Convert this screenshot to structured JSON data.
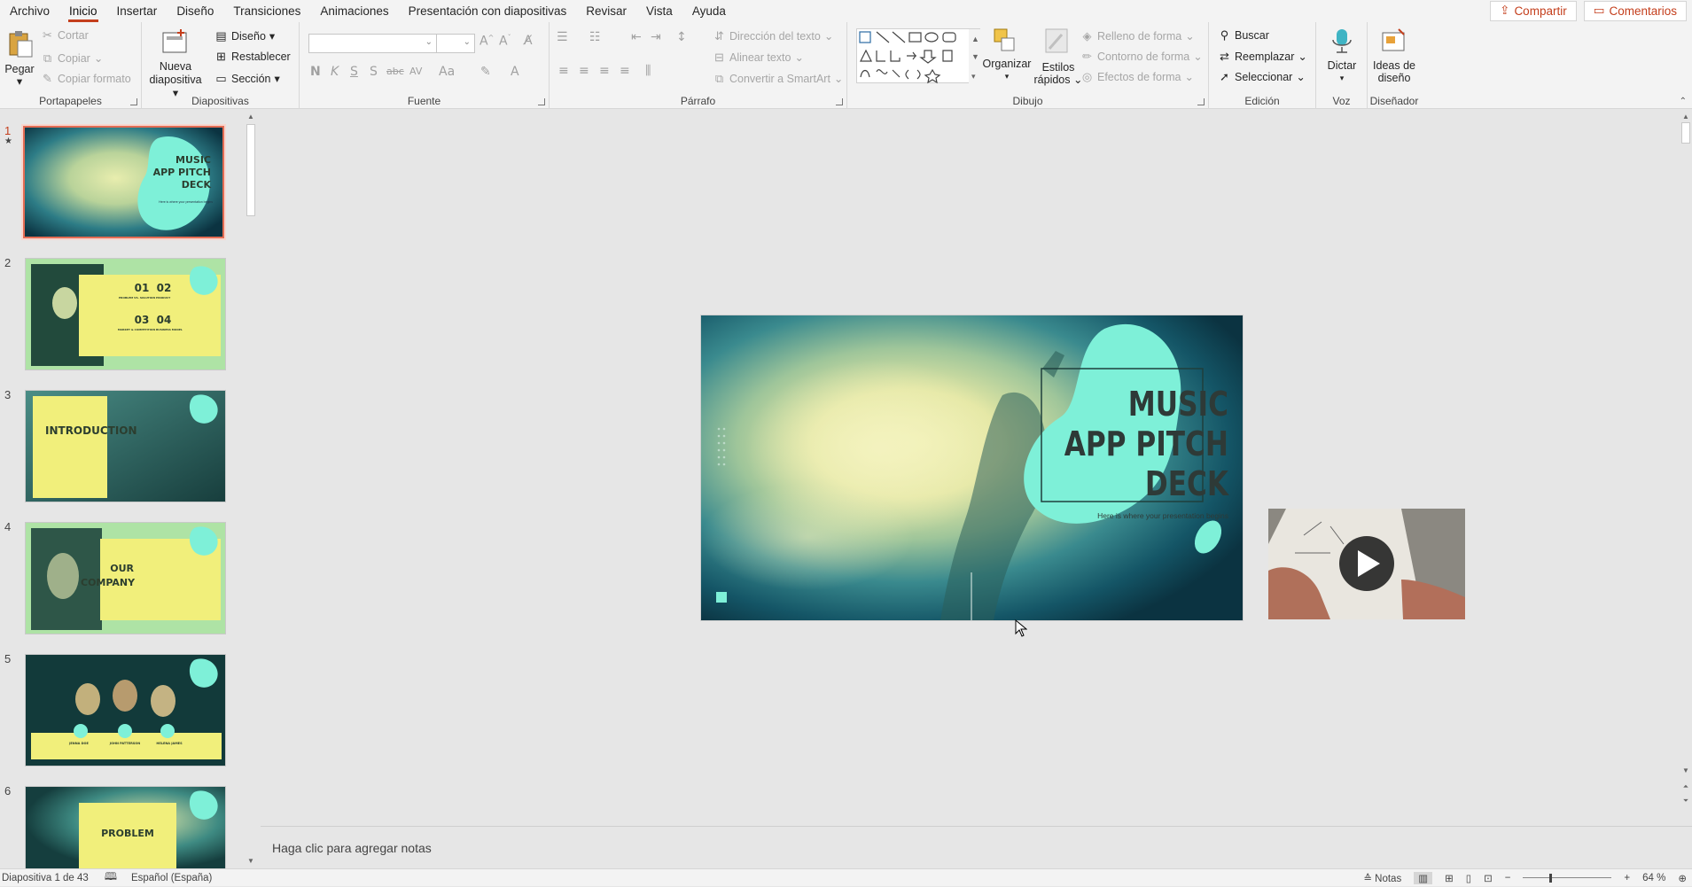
{
  "menu": {
    "tabs": [
      "Archivo",
      "Inicio",
      "Insertar",
      "Diseño",
      "Transiciones",
      "Animaciones",
      "Presentación con diapositivas",
      "Revisar",
      "Vista",
      "Ayuda"
    ],
    "active": "Inicio",
    "share_label": "Compartir",
    "comments_label": "Comentarios"
  },
  "ribbon": {
    "portapapeles": {
      "label": "Portapapeles",
      "paste": "Pegar",
      "cut": "Cortar",
      "copy": "Copiar",
      "format_painter": "Copiar formato"
    },
    "diapositivas": {
      "label": "Diapositivas",
      "new_slide_1": "Nueva",
      "new_slide_2": "diapositiva",
      "layout": "Diseño",
      "reset": "Restablecer",
      "section": "Sección"
    },
    "fuente": {
      "label": "Fuente",
      "bold": "N",
      "italic": "K",
      "underline": "S",
      "shadow": "S",
      "strike": "abc",
      "spacing": "AV",
      "case": "Aa"
    },
    "parrafo": {
      "label": "Párrafo",
      "text_direction": "Dirección del texto",
      "align_text": "Alinear texto",
      "smartart": "Convertir a SmartArt"
    },
    "dibujo": {
      "label": "Dibujo",
      "arrange": "Organizar",
      "styles_1": "Estilos",
      "styles_2": "rápidos",
      "fill": "Relleno de forma",
      "outline": "Contorno de forma",
      "effects": "Efectos de forma"
    },
    "edicion": {
      "label": "Edición",
      "find": "Buscar",
      "replace": "Reemplazar",
      "select": "Seleccionar"
    },
    "voz": {
      "label": "Voz",
      "dictate": "Dictar"
    },
    "disenador": {
      "label": "Diseñador",
      "ideas_1": "Ideas de",
      "ideas_2": "diseño"
    }
  },
  "thumbnails": [
    {
      "num": "1",
      "star": "★",
      "title_lines": [
        "MUSIC",
        "APP PITCH",
        "DECK"
      ],
      "subtitle": "Here is where your presentation begins"
    },
    {
      "num": "2",
      "nums": [
        "01",
        "02",
        "03",
        "04"
      ],
      "labels": [
        "PROBLEM VS. SOLUTION",
        "PRODUCT",
        "MARKET & COMPETITION",
        "BUSINESS MODEL"
      ]
    },
    {
      "num": "3",
      "title": "INTRODUCTION"
    },
    {
      "num": "4",
      "title_lines": [
        "OUR",
        "COMPANY"
      ]
    },
    {
      "num": "5",
      "names": [
        "JENNA DOE",
        "JOHN PATTERSON",
        "HELENA JAMES"
      ]
    },
    {
      "num": "6",
      "title": "PROBLEM"
    }
  ],
  "slide": {
    "title_lines": [
      "MUSIC",
      "APP PITCH",
      "DECK"
    ],
    "subtitle": "Here is where your presentation begins",
    "accent": "#7ef0d8",
    "bg_dark": "#0f3b45"
  },
  "notes_placeholder": "Haga clic para agregar notas",
  "status": {
    "slide_info": "Diapositiva 1 de 43",
    "language": "Español (España)",
    "notes": "Notas",
    "zoom": "64 %",
    "zoom_percent": 64
  }
}
